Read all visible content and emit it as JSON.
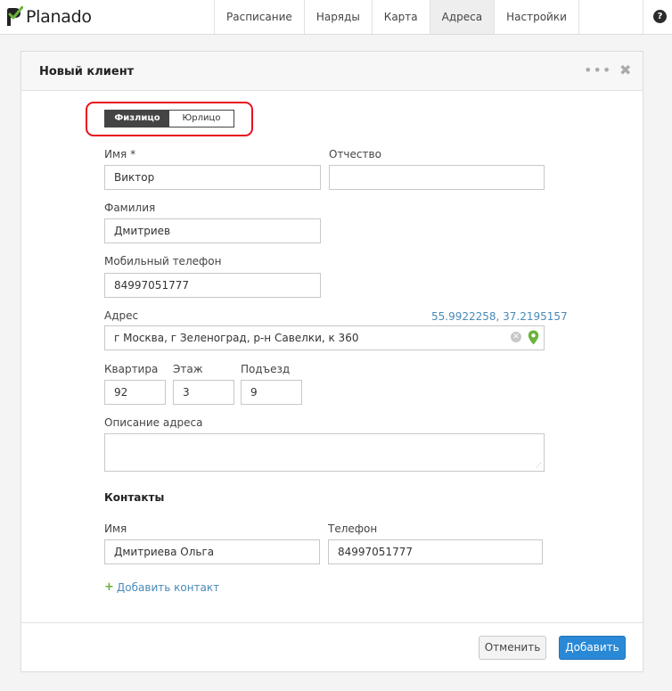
{
  "app": {
    "logo_text": "Planado"
  },
  "nav": {
    "tabs": [
      {
        "label": "Расписание"
      },
      {
        "label": "Наряды"
      },
      {
        "label": "Карта"
      },
      {
        "label": "Адреса",
        "active": true
      },
      {
        "label": "Настройки"
      }
    ],
    "help_glyph": "?"
  },
  "modal": {
    "title": "Новый клиент",
    "menu_glyph": "•••",
    "close_glyph": "✖"
  },
  "client_type": {
    "options": [
      "Физлицо",
      "Юрлицо"
    ],
    "selected": "Физлицо"
  },
  "form": {
    "first_name": {
      "label": "Имя *",
      "value": "Виктор"
    },
    "middle_name": {
      "label": "Отчество",
      "value": ""
    },
    "last_name": {
      "label": "Фамилия",
      "value": "Дмитриев"
    },
    "mobile": {
      "label": "Мобильный телефон",
      "value": "84997051777"
    },
    "address": {
      "label": "Адрес",
      "value": "г Москва, г Зеленоград, р-н Савелки, к 360",
      "coordinates": "55.9922258, 37.2195157"
    },
    "apartment": {
      "label": "Квартира",
      "value": "92"
    },
    "floor": {
      "label": "Этаж",
      "value": "3"
    },
    "entrance": {
      "label": "Подъезд",
      "value": "9"
    },
    "address_description": {
      "label": "Описание адреса",
      "value": ""
    }
  },
  "contacts": {
    "section_title": "Контакты",
    "name_label": "Имя",
    "phone_label": "Телефон",
    "items": [
      {
        "name": "Дмитриева Ольга",
        "phone": "84997051777"
      }
    ],
    "add_label": "Добавить контакт"
  },
  "actions": {
    "cancel_label": "Отменить",
    "submit_label": "Добавить"
  },
  "colors": {
    "accent_blue": "#2a89d6",
    "link_blue": "#4a8ab8",
    "highlight_red": "#e8101f",
    "pin_green": "#6bb33a"
  }
}
